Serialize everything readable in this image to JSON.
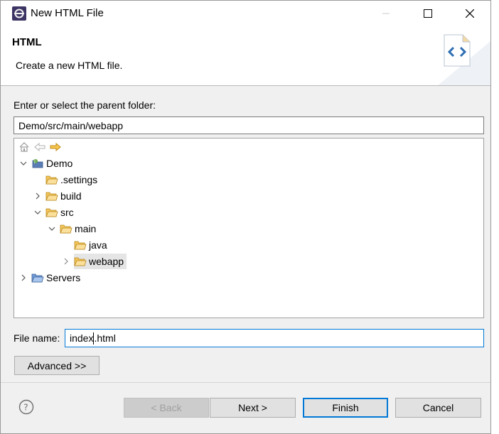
{
  "window": {
    "title": "New HTML File"
  },
  "banner": {
    "title": "HTML",
    "description": "Create a new HTML file."
  },
  "parent_folder": {
    "label": "Enter or select the parent folder:",
    "value": "Demo/src/main/webapp"
  },
  "tree": {
    "toolbar": [
      "home-icon",
      "back-arrow-icon",
      "forward-arrow-icon"
    ],
    "items": [
      {
        "label": "Demo",
        "icon": "project-icon",
        "twisty": "expanded"
      },
      {
        "label": ".settings",
        "icon": "folder-icon",
        "twisty": "none"
      },
      {
        "label": "build",
        "icon": "folder-icon",
        "twisty": "collapsed"
      },
      {
        "label": "src",
        "icon": "folder-icon",
        "twisty": "expanded"
      },
      {
        "label": "main",
        "icon": "folder-icon",
        "twisty": "expanded"
      },
      {
        "label": "java",
        "icon": "folder-icon",
        "twisty": "none"
      },
      {
        "label": "webapp",
        "icon": "folder-icon",
        "twisty": "collapsed",
        "selected": true
      },
      {
        "label": "Servers",
        "icon": "folder-icon",
        "twisty": "collapsed"
      }
    ]
  },
  "file_name": {
    "label": "File name:",
    "value_before_caret": "index",
    "value_after_caret": ".html"
  },
  "buttons": {
    "advanced": "Advanced >>",
    "back": "< Back",
    "next": "Next >",
    "finish": "Finish",
    "cancel": "Cancel"
  },
  "colors": {
    "accent": "#0078d7",
    "folder": "#e8b24a",
    "dialog_bg": "#f0f0f0"
  }
}
